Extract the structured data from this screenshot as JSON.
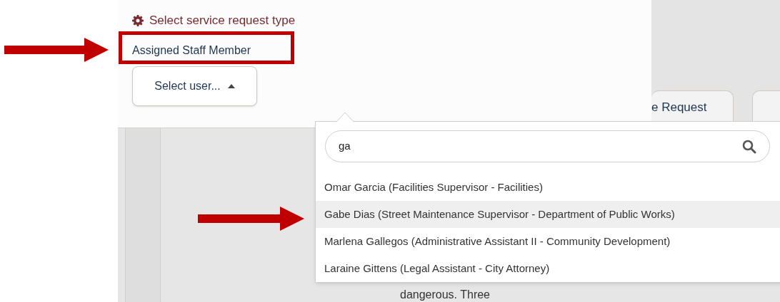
{
  "form": {
    "section_link": "Select service request type",
    "field_label": "Assigned Staff Member",
    "user_select": {
      "value": "Select user...",
      "expanded": true
    }
  },
  "toolbar": {
    "buttons": [
      "e Request"
    ]
  },
  "background_text": "dangerous. Three",
  "dropdown": {
    "search": {
      "value": "ga"
    },
    "options": [
      {
        "label": "Omar Garcia (Facilities Supervisor - Facilities)",
        "selected": false
      },
      {
        "label": "Gabe Dias (Street Maintenance Supervisor - Department of Public Works)",
        "selected": true
      },
      {
        "label": "Marlena Gallegos (Administrative Assistant II - Community Development)",
        "selected": false
      },
      {
        "label": "Laraine Gittens (Legal Assistant - City Attorney)",
        "selected": false
      }
    ]
  }
}
